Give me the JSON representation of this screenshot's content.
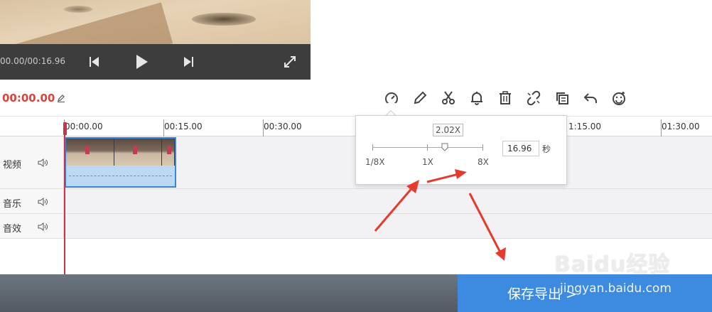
{
  "player": {
    "time_display": "00.00/00:16.96"
  },
  "toolbar": {
    "current_time": "00:00.00"
  },
  "timeline": {
    "ruler_labels": [
      "00:00.00",
      "00:15.00",
      "00:30.00",
      "1:15.00",
      "01:30.00"
    ],
    "tracks": [
      {
        "name": "视频"
      },
      {
        "name": "音乐"
      },
      {
        "name": "音效"
      }
    ]
  },
  "speed_popup": {
    "speed_value": "2.02X",
    "min_label": "1/8X",
    "mid_label": "1X",
    "max_label": "8X",
    "duration_value": "16.96",
    "duration_unit": "秒"
  },
  "footer": {
    "export_label": "保存导出 >"
  },
  "watermark": {
    "logo_text": "Baidu经验",
    "url_text": "jingyan.baidu.com"
  },
  "colors": {
    "time_red": "#d9433a",
    "export_blue": "#3d8be0",
    "playhead": "#c9344a",
    "annotation_red": "#e8392e"
  }
}
